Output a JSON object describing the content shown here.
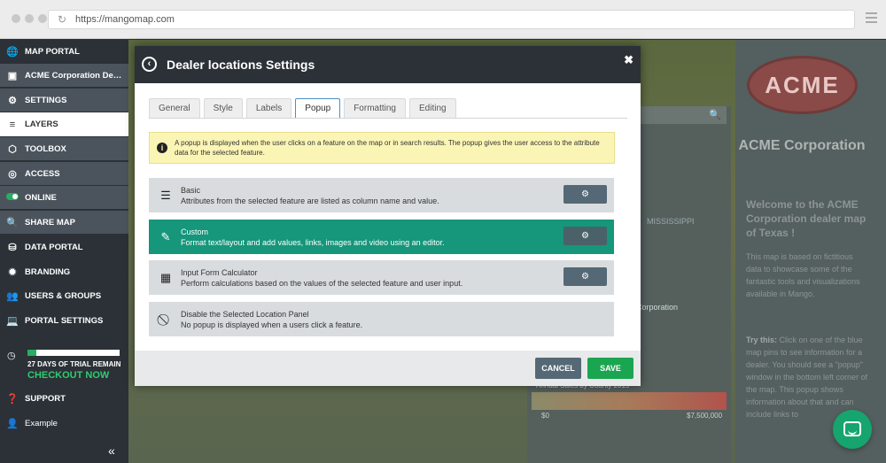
{
  "browser": {
    "url": "https://mangomap.com"
  },
  "sidebar": {
    "items": [
      {
        "label": "MAP PORTAL",
        "icon": "globe-icon"
      },
      {
        "label": "ACME Corporation Dealer Map",
        "icon": "map-icon"
      },
      {
        "label": "SETTINGS",
        "icon": "gear-icon"
      },
      {
        "label": "LAYERS",
        "icon": "layers-icon"
      },
      {
        "label": "TOOLBOX",
        "icon": "cube-icon"
      },
      {
        "label": "ACCESS",
        "icon": "lock-icon"
      },
      {
        "label": "ONLINE",
        "icon": "toggle-icon"
      },
      {
        "label": "SHARE MAP",
        "icon": "share-icon"
      },
      {
        "label": "DATA PORTAL",
        "icon": "database-icon"
      },
      {
        "label": "BRANDING",
        "icon": "badge-icon"
      },
      {
        "label": "USERS & GROUPS",
        "icon": "users-icon"
      },
      {
        "label": "PORTAL SETTINGS",
        "icon": "laptop-icon"
      }
    ],
    "trial": {
      "text": "27 DAYS OF TRIAL REMAIN",
      "cta": "CHECKOUT NOW",
      "progress": 0.1
    },
    "support": "SUPPORT",
    "user": "Example"
  },
  "map": {
    "state_label": "MISSISSIPPI",
    "corp_label": "Corporation",
    "chart_title": "Annual Sales by County 2019",
    "chart_min": "$0",
    "chart_max": "$7,500,000"
  },
  "info_panel": {
    "logo": "ACME",
    "title": "ACME Corporation",
    "welcome": "Welcome to the ACME Corporation dealer map of Texas !",
    "para1": "This map is based on fictitious data to showcase some of the fantastic tools and visualizations available in Mango.",
    "try_label": "Try this:",
    "para2": "Click on one of the blue map pins to see information for a dealer. You should see a \"popup\" window in the bottom left corner of the map. This popup shows information about that",
    "para2b": "and can include links to"
  },
  "modal": {
    "title": "Dealer locations Settings",
    "tabs": [
      "General",
      "Style",
      "Labels",
      "Popup",
      "Formatting",
      "Editing"
    ],
    "active_tab": "Popup",
    "notice": "A popup is displayed when the user clicks on a feature on the map or in search results. The popup gives the user access to the attribute data for the selected feature.",
    "options": [
      {
        "title": "Basic",
        "desc": "Attributes from the selected feature are listed as column name and value.",
        "icon": "list-icon"
      },
      {
        "title": "Custom",
        "desc": "Format text/layout and add values, links, images and video using an editor.",
        "icon": "pencil-icon"
      },
      {
        "title": "Input Form Calculator",
        "desc": "Perform calculations based on the values of the selected feature and user input.",
        "icon": "calculator-icon"
      },
      {
        "title": "Disable the Selected Location Panel",
        "desc": "No popup is displayed when a users click a feature.",
        "icon": "ban-icon"
      }
    ],
    "selected_option": "Custom",
    "cancel_label": "CANCEL",
    "save_label": "SAVE"
  }
}
